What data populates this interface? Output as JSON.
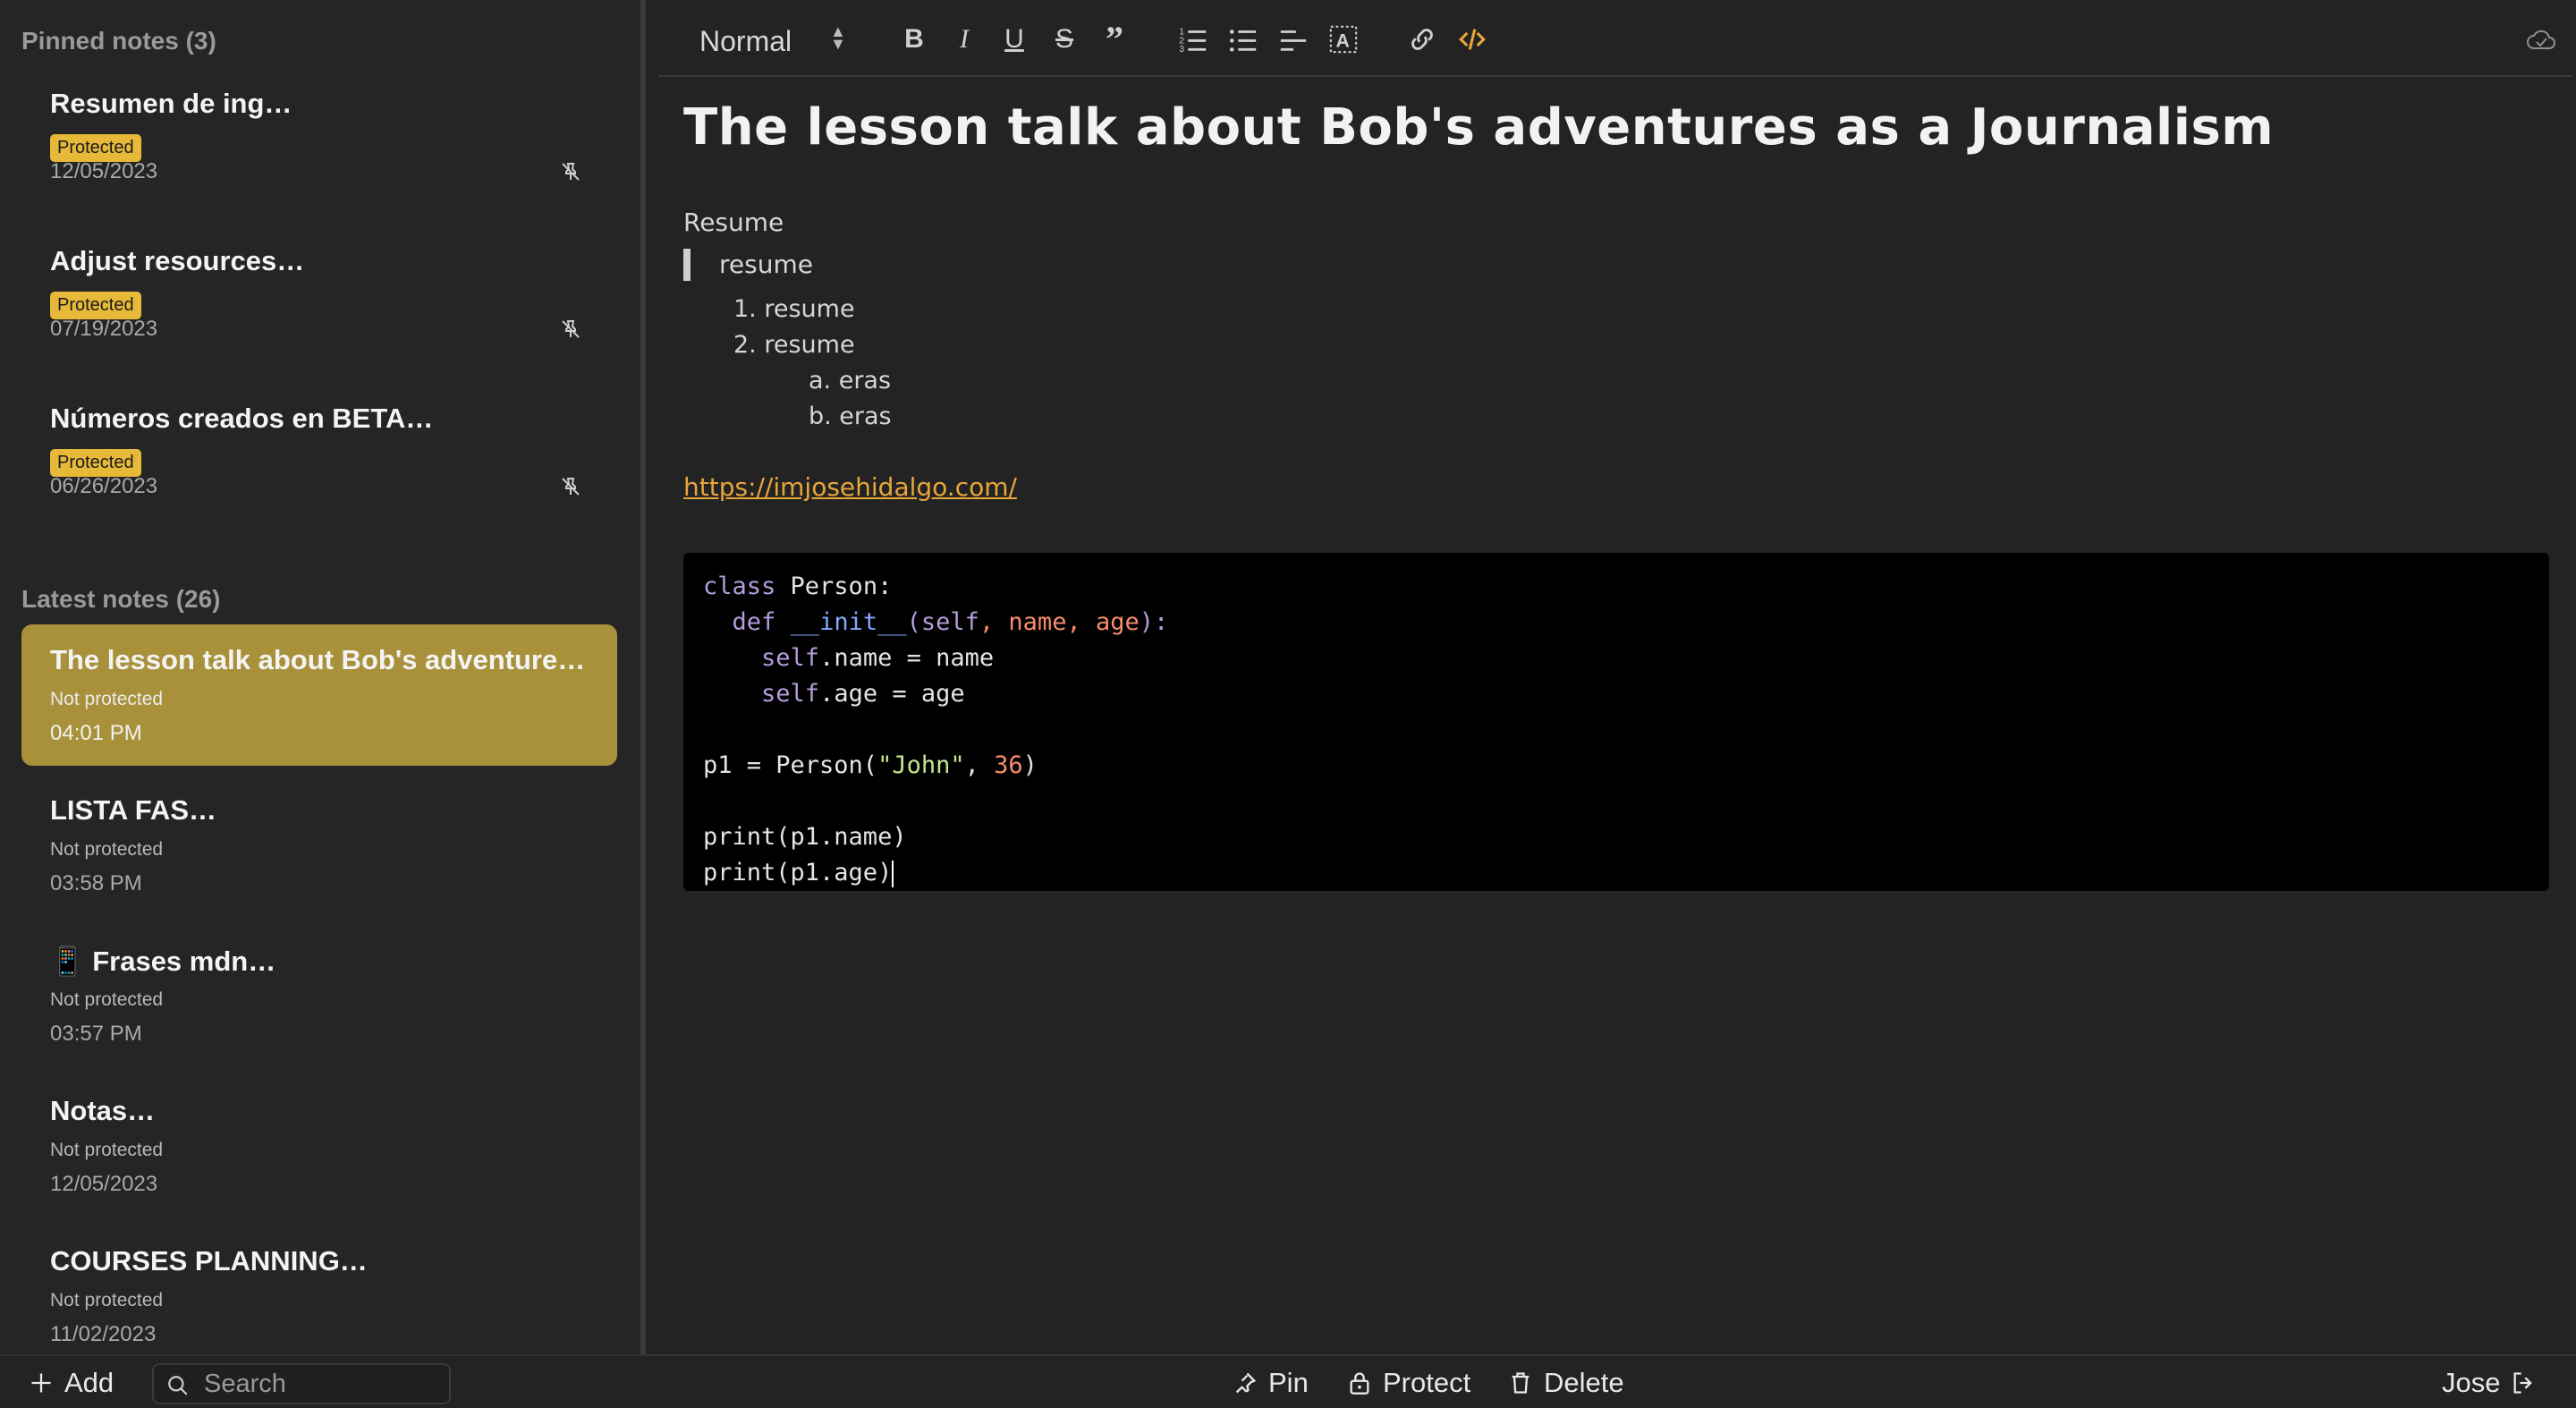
{
  "sidebar": {
    "pinned_title": "Pinned notes (3)",
    "pinned": [
      {
        "title": "Resumen de ing…",
        "badge": "Protected",
        "date": "12/05/2023"
      },
      {
        "title": "Adjust resources…",
        "badge": "Protected",
        "date": "07/19/2023"
      },
      {
        "title": "Números creados en BETA…",
        "badge": "Protected",
        "date": "06/26/2023"
      }
    ],
    "latest_title": "Latest notes (26)",
    "latest": [
      {
        "title": "The lesson talk about Bob's adventure…",
        "status": "Not protected",
        "date": "04:01 PM"
      },
      {
        "title": "LISTA FAS…",
        "status": "Not protected",
        "date": "03:58 PM"
      },
      {
        "title": "📱 Frases mdn…",
        "status": "Not protected",
        "date": "03:57 PM"
      },
      {
        "title": "Notas…",
        "status": "Not protected",
        "date": "12/05/2023"
      },
      {
        "title": "COURSES PLANNING…",
        "status": "Not protected",
        "date": "11/02/2023"
      }
    ]
  },
  "toolbar": {
    "format": "Normal",
    "icons": [
      "bold-icon",
      "italic-icon",
      "underline-icon",
      "strikethrough-icon",
      "quote-icon",
      "ordered-list-icon",
      "bullet-list-icon",
      "align-left-icon",
      "clear-format-icon",
      "link-icon",
      "code-icon",
      "cloud-sync-icon"
    ],
    "accent": "#e6a63a"
  },
  "document": {
    "title": "The lesson talk about Bob's adventures as a Journalism",
    "paragraph": "Resume",
    "quote": "resume",
    "list": [
      "1. resume",
      "2. resume"
    ],
    "sublist": [
      "a. eras",
      "b. eras"
    ],
    "link": "https://imjosehidalgo.com/",
    "code": {
      "line1_kw": "class",
      "line1_rest": " Person:",
      "line2_kw": "def",
      "line2_fn": "__init__",
      "line2_open": "(",
      "line2_self": "self",
      "line2_c1": ", ",
      "line2_name": "name",
      "line2_c2": ", ",
      "line2_age": "age",
      "line2_close": "):",
      "line3_self": "self",
      "line3_rest": ".name = name",
      "line4_self": "self",
      "line4_rest": ".age = age",
      "line5_a": "p1 = Person(",
      "line5_str": "\"John\"",
      "line5_c": ", ",
      "line5_num": "36",
      "line5_b": ")",
      "line6": "print(p1.name)",
      "line7": "print(p1.age)"
    }
  },
  "bottom": {
    "add": "Add",
    "search_placeholder": "Search",
    "pin": "Pin",
    "protect": "Protect",
    "delete": "Delete",
    "user": "Jose"
  },
  "colors": {
    "active_note": "#a8913a",
    "badge": "#e7b938"
  }
}
